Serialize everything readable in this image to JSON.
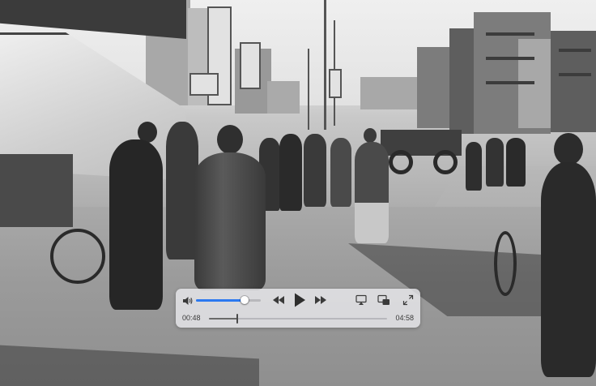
{
  "player": {
    "current_time": "00:48",
    "duration": "04:58",
    "progress": 0.161,
    "volume": 0.75,
    "state": "paused",
    "icons": {
      "volume": "speaker-volume-icon",
      "rewind": "rewind-icon",
      "play": "play-icon",
      "fast_forward": "fast-forward-icon",
      "airplay": "airplay-icon",
      "pip": "picture-in-picture-icon",
      "expand": "expand-icon"
    },
    "colors": {
      "volume_fill": "#2c79f0",
      "panel": "#e8e8eb"
    }
  }
}
